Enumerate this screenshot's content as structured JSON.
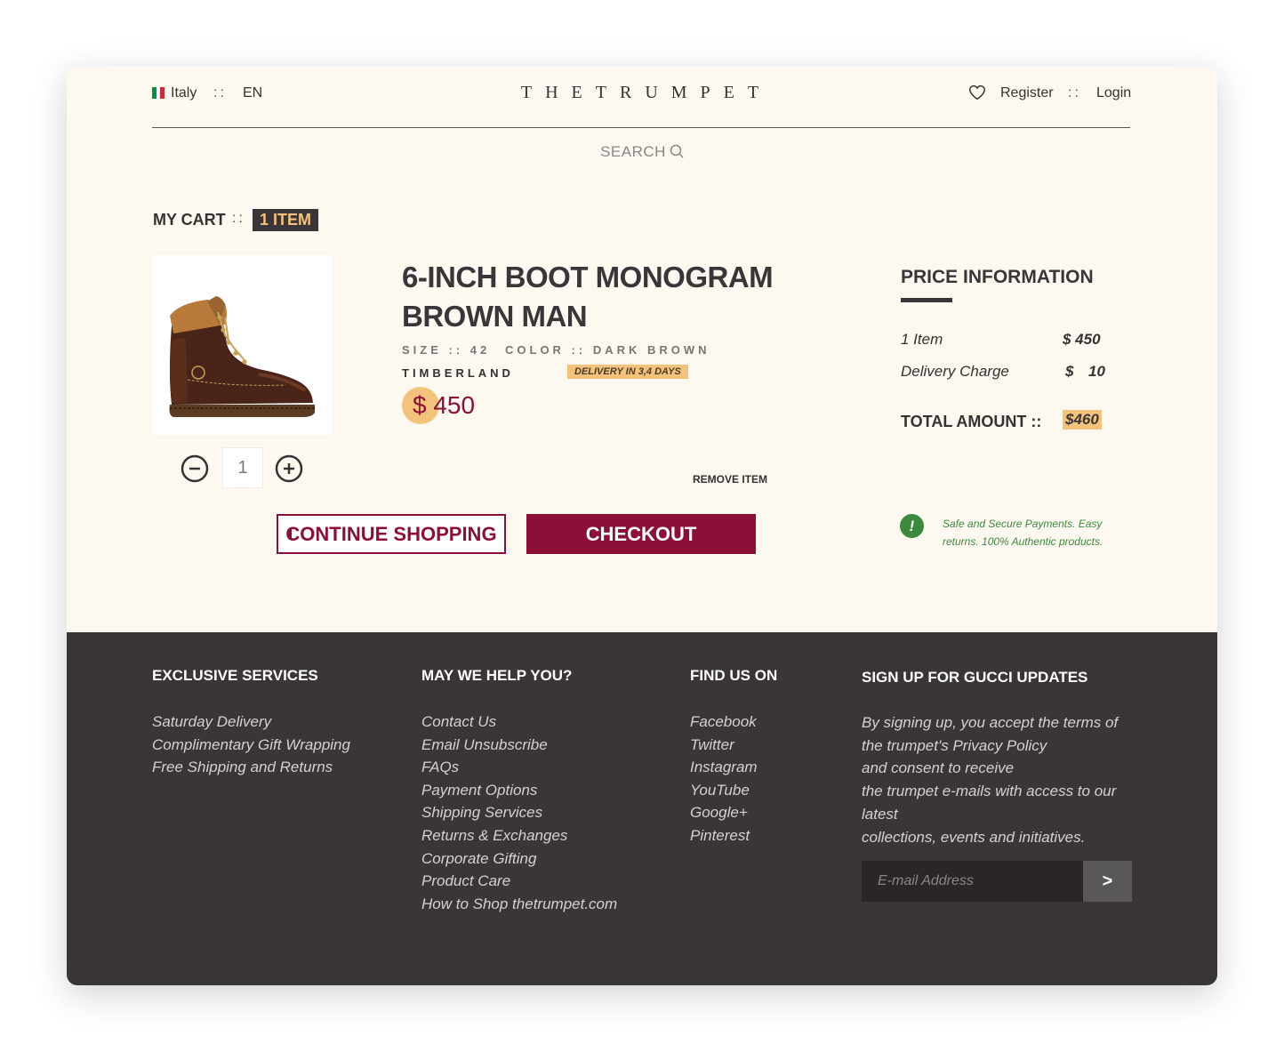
{
  "header": {
    "country": "Italy",
    "separator": "::",
    "language": "EN",
    "logo": "THETRUMPET",
    "register": "Register",
    "login": "Login",
    "search": "SEARCH",
    "flag_colors": [
      "#009246",
      "#ffffff",
      "#ce2b37"
    ]
  },
  "cart": {
    "title": "MY CART",
    "separator": "::",
    "items_badge": "1 ITEM",
    "quantity": "1",
    "product": {
      "title": "6-INCH BOOT MONOGRAM BROWN MAN",
      "size": "SIZE :: 42",
      "color": "COLOR :: DARK BROWN",
      "brand": "TIMBERLAND",
      "delivery": "DELIVERY IN 3,4 DAYS",
      "price": "$ 450",
      "image": "brown-leather-boot"
    },
    "remove_label": "REMOVE ITEM",
    "continue_label": "CONTINUE SHOPPING",
    "checkout_label": "CHECKOUT"
  },
  "price_info": {
    "title": "PRICE INFORMATION",
    "item_label": "1 Item",
    "item_value": "$ 450",
    "delivery_label": "Delivery Charge",
    "delivery_currency": "$",
    "delivery_value": "10",
    "total_label": "TOTAL AMOUNT ::",
    "total_value": "$460",
    "secure_icon": "!",
    "secure_text": "Safe and Secure Payments. Easy returns. 100% Authentic products."
  },
  "footer": {
    "col1": {
      "title": "EXCLUSIVE SERVICES",
      "items": [
        "Saturday Delivery",
        "Complimentary Gift Wrapping",
        "Free Shipping and Returns"
      ]
    },
    "col2": {
      "title": "MAY WE HELP YOU?",
      "items": [
        "Contact Us",
        "Email Unsubscribe",
        "FAQs",
        "Payment Options",
        "Shipping Services",
        "Returns & Exchanges",
        "Corporate Gifting",
        "Product Care",
        "How to Shop thetrumpet.com"
      ]
    },
    "col3": {
      "title": "FIND US ON",
      "items": [
        "Facebook",
        "Twitter",
        "Instagram",
        "YouTube",
        "Google+",
        "Pinterest"
      ]
    },
    "signup": {
      "title": "SIGN UP FOR GUCCI UPDATES",
      "lines": [
        "By signing up, you accept the terms of",
        "the trumpet's Privacy Policy",
        "and consent to receive",
        "the trumpet e-mails with access to our latest",
        "collections, events and initiatives."
      ],
      "placeholder": "E-mail Address",
      "submit": ">"
    }
  },
  "colors": {
    "accent": "#8b0f36",
    "highlight": "#f3c37c",
    "dark": "#3a3538",
    "background": "#fdf9f1",
    "success": "#3c8a3c"
  }
}
